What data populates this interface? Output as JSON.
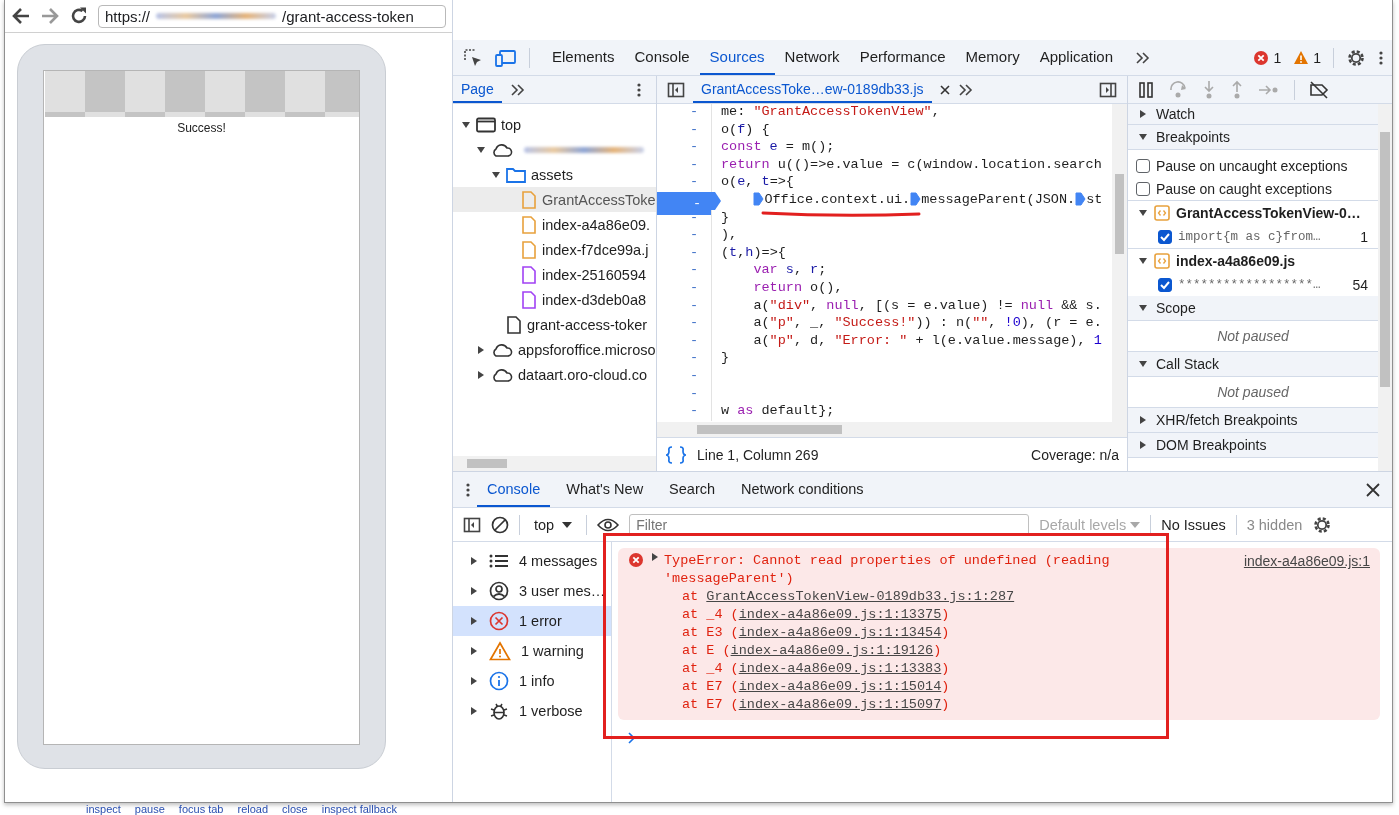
{
  "browser": {
    "url_scheme": "https://",
    "url_redacted": true,
    "url_path": "/grant-access-token"
  },
  "page": {
    "message": "Success!"
  },
  "devtools": {
    "main_tabs": [
      {
        "label": "Elements",
        "selected": false
      },
      {
        "label": "Console",
        "selected": false
      },
      {
        "label": "Sources",
        "selected": true
      },
      {
        "label": "Network",
        "selected": false
      },
      {
        "label": "Performance",
        "selected": false
      },
      {
        "label": "Memory",
        "selected": false
      },
      {
        "label": "Application",
        "selected": false
      }
    ],
    "errors": "1",
    "warnings": "1",
    "navigator": {
      "tabs": [
        {
          "label": "Page",
          "selected": true
        }
      ],
      "tree": [
        {
          "label": "top",
          "kind": "frame",
          "expanded": true,
          "selected": false,
          "children": [
            {
              "kind": "domain",
              "redacted": true,
              "expanded": true,
              "selected": false,
              "children": [
                {
                  "label": "assets",
                  "kind": "folder",
                  "expanded": true,
                  "selected": false,
                  "children": [
                    {
                      "label": "GrantAccessToke",
                      "kind": "script",
                      "selected": true
                    },
                    {
                      "label": "index-a4a86e09.",
                      "kind": "script",
                      "selected": false
                    },
                    {
                      "label": "index-f7dce99a.j",
                      "kind": "script",
                      "selected": false
                    },
                    {
                      "label": "index-25160594",
                      "kind": "stylesheet",
                      "selected": false
                    },
                    {
                      "label": "index-d3deb0a8",
                      "kind": "stylesheet",
                      "selected": false
                    }
                  ]
                },
                {
                  "label": "grant-access-toker",
                  "kind": "document",
                  "selected": false
                }
              ]
            },
            {
              "label": "appsforoffice.microso",
              "kind": "domain",
              "expanded": false,
              "selected": false
            },
            {
              "label": "dataart.oro-cloud.co",
              "kind": "domain",
              "expanded": false,
              "selected": false
            }
          ]
        }
      ]
    },
    "editor": {
      "tabs": [
        {
          "label": "GrantAccessToke…ew-0189db33.js",
          "selected": true
        }
      ],
      "lines": [
        {
          "gutter": "-",
          "breakpoint": false,
          "segments": [
            {
              "text": "me: ",
              "kind": "plain"
            },
            {
              "text": "\"GrantAccessTokenView\"",
              "kind": "string"
            },
            {
              "text": ",",
              "kind": "plain"
            }
          ]
        },
        {
          "gutter": "-",
          "breakpoint": false,
          "segments": [
            {
              "text": "o(",
              "kind": "plain"
            },
            {
              "text": "f",
              "kind": "variable"
            },
            {
              "text": ") {",
              "kind": "plain"
            }
          ]
        },
        {
          "gutter": "-",
          "breakpoint": false,
          "segments": [
            {
              "text": "const",
              "kind": "keyword"
            },
            {
              "text": " e",
              "kind": "variable"
            },
            {
              "text": " = m();",
              "kind": "plain"
            }
          ]
        },
        {
          "gutter": "-",
          "breakpoint": false,
          "segments": [
            {
              "text": "return",
              "kind": "keyword"
            },
            {
              "text": " u(()=>e.value = c(window.location.search",
              "kind": "plain"
            }
          ]
        },
        {
          "gutter": "-",
          "breakpoint": false,
          "segments": [
            {
              "text": "o(",
              "kind": "plain"
            },
            {
              "text": "e",
              "kind": "variable"
            },
            {
              "text": ", ",
              "kind": "plain"
            },
            {
              "text": "t",
              "kind": "variable"
            },
            {
              "text": "=>{",
              "kind": "plain"
            }
          ]
        },
        {
          "gutter": "-",
          "breakpoint": true,
          "indented": true,
          "segments": [
            {
              "kind": "inline-breakpoint"
            },
            {
              "text": "Office.context.ui.",
              "kind": "plain"
            },
            {
              "kind": "inline-breakpoint"
            },
            {
              "text": "messageParent(JSON.",
              "kind": "plain"
            },
            {
              "kind": "inline-breakpoint"
            },
            {
              "text": "st",
              "kind": "plain"
            }
          ]
        },
        {
          "gutter": "-",
          "breakpoint": false,
          "segments": [
            {
              "text": "}",
              "kind": "plain"
            }
          ]
        },
        {
          "gutter": "-",
          "breakpoint": false,
          "segments": [
            {
              "text": "),",
              "kind": "plain"
            }
          ]
        },
        {
          "gutter": "-",
          "breakpoint": false,
          "segments": [
            {
              "text": "(",
              "kind": "plain"
            },
            {
              "text": "t",
              "kind": "variable"
            },
            {
              "text": ",",
              "kind": "plain"
            },
            {
              "text": "h",
              "kind": "variable"
            },
            {
              "text": ")=>{",
              "kind": "plain"
            }
          ]
        },
        {
          "gutter": "-",
          "breakpoint": false,
          "indented": true,
          "segments": [
            {
              "text": "var",
              "kind": "keyword"
            },
            {
              "text": " s",
              "kind": "variable"
            },
            {
              "text": ", ",
              "kind": "plain"
            },
            {
              "text": "r",
              "kind": "variable"
            },
            {
              "text": ";",
              "kind": "plain"
            }
          ]
        },
        {
          "gutter": "-",
          "breakpoint": false,
          "indented": true,
          "segments": [
            {
              "text": "return",
              "kind": "keyword"
            },
            {
              "text": " o(),",
              "kind": "plain"
            }
          ]
        },
        {
          "gutter": "-",
          "breakpoint": false,
          "indented": true,
          "segments": [
            {
              "text": "a(",
              "kind": "plain"
            },
            {
              "text": "\"div\"",
              "kind": "string"
            },
            {
              "text": ", ",
              "kind": "plain"
            },
            {
              "text": "null",
              "kind": "keyword"
            },
            {
              "text": ", [(s = e.value) != ",
              "kind": "plain"
            },
            {
              "text": "null",
              "kind": "keyword"
            },
            {
              "text": " && s.",
              "kind": "plain"
            }
          ]
        },
        {
          "gutter": "-",
          "breakpoint": false,
          "indented": true,
          "segments": [
            {
              "text": "a(",
              "kind": "plain"
            },
            {
              "text": "\"p\"",
              "kind": "string"
            },
            {
              "text": ", _, ",
              "kind": "plain"
            },
            {
              "text": "\"Success!\"",
              "kind": "string"
            },
            {
              "text": ")) : n(",
              "kind": "plain"
            },
            {
              "text": "\"\"",
              "kind": "string"
            },
            {
              "text": ", ",
              "kind": "plain"
            },
            {
              "text": "!0",
              "kind": "number"
            },
            {
              "text": "), (r = e.",
              "kind": "plain"
            }
          ]
        },
        {
          "gutter": "-",
          "breakpoint": false,
          "indented": true,
          "segments": [
            {
              "text": "a(",
              "kind": "plain"
            },
            {
              "text": "\"p\"",
              "kind": "string"
            },
            {
              "text": ", d, ",
              "kind": "plain"
            },
            {
              "text": "\"Error: \"",
              "kind": "string"
            },
            {
              "text": " + l(e.value.message), ",
              "kind": "plain"
            },
            {
              "text": "1",
              "kind": "number"
            }
          ]
        },
        {
          "gutter": "-",
          "breakpoint": false,
          "segments": [
            {
              "text": "}",
              "kind": "plain"
            }
          ]
        },
        {
          "gutter": "-",
          "breakpoint": false
        },
        {
          "gutter": "-",
          "breakpoint": false
        },
        {
          "gutter": "-",
          "breakpoint": false,
          "segments": [
            {
              "text": "w ",
              "kind": "plain"
            },
            {
              "text": "as",
              "kind": "keyword"
            },
            {
              "text": " default};",
              "kind": "plain"
            }
          ]
        }
      ],
      "status": "Line 1, Column 269",
      "coverage": "Coverage: n/a"
    },
    "debugger": {
      "sections": [
        {
          "title": "Watch",
          "expanded": false
        },
        {
          "title": "Breakpoints",
          "expanded": true,
          "items": [
            {
              "kind": "option",
              "label": "Pause on uncaught exceptions",
              "checked": false
            },
            {
              "kind": "option",
              "label": "Pause on caught exceptions",
              "checked": false
            },
            {
              "kind": "file",
              "label": "GrantAccessTokenView-0…",
              "expanded": true
            },
            {
              "kind": "breakpoint",
              "code": "import{m as c}from…",
              "line": "1",
              "checked": true
            },
            {
              "kind": "file",
              "label": "index-a4a86e09.js",
              "expanded": true
            },
            {
              "kind": "breakpoint",
              "code": "******************…",
              "line": "54",
              "checked": true
            }
          ]
        },
        {
          "title": "Scope",
          "expanded": true,
          "message": "Not paused"
        },
        {
          "title": "Call Stack",
          "expanded": true,
          "message": "Not paused"
        },
        {
          "title": "XHR/fetch Breakpoints",
          "expanded": false
        },
        {
          "title": "DOM Breakpoints",
          "expanded": false
        }
      ]
    },
    "drawer": {
      "tabs": [
        {
          "label": "Console",
          "selected": true
        },
        {
          "label": "What's New",
          "selected": false
        },
        {
          "label": "Search",
          "selected": false
        },
        {
          "label": "Network conditions",
          "selected": false
        }
      ],
      "context": "top",
      "filter": {
        "placeholder": "Filter"
      },
      "levels": {
        "label": "Default levels",
        "disabled": true
      },
      "issues": "No Issues",
      "hidden": "3 hidden",
      "groups": [
        {
          "label": "4 messages",
          "kind": "messages",
          "selected": false
        },
        {
          "label": "3 user mes…",
          "kind": "user",
          "selected": false
        },
        {
          "label": "1 error",
          "kind": "error",
          "selected": true
        },
        {
          "label": "1 warning",
          "kind": "warning",
          "selected": false
        },
        {
          "label": "1 info",
          "kind": "info",
          "selected": false
        },
        {
          "label": "1 verbose",
          "kind": "verbose",
          "selected": false
        }
      ],
      "messages": [
        {
          "kind": "error",
          "expanded": false,
          "text": "TypeError: Cannot read properties of undefined (reading 'messageParent')",
          "source": "index-a4a86e09.js:1",
          "stack": [
            {
              "prefix": "at ",
              "link": "GrantAccessTokenView-0189db33.js:1:287"
            },
            {
              "prefix": "at _4 (",
              "link": "index-a4a86e09.js:1:13375",
              "suffix": ")"
            },
            {
              "prefix": "at E3 (",
              "link": "index-a4a86e09.js:1:13454",
              "suffix": ")"
            },
            {
              "prefix": "at E (",
              "link": "index-a4a86e09.js:1:19126",
              "suffix": ")"
            },
            {
              "prefix": "at _4 (",
              "link": "index-a4a86e09.js:1:13383",
              "suffix": ")"
            },
            {
              "prefix": "at E7 (",
              "link": "index-a4a86e09.js:1:15014",
              "suffix": ")"
            },
            {
              "prefix": "at E7 (",
              "link": "index-a4a86e09.js:1:15097",
              "suffix": ")"
            }
          ]
        }
      ]
    }
  },
  "footer_links": [
    "inspect",
    "pause",
    "focus tab",
    "reload",
    "close",
    "inspect fallback"
  ]
}
